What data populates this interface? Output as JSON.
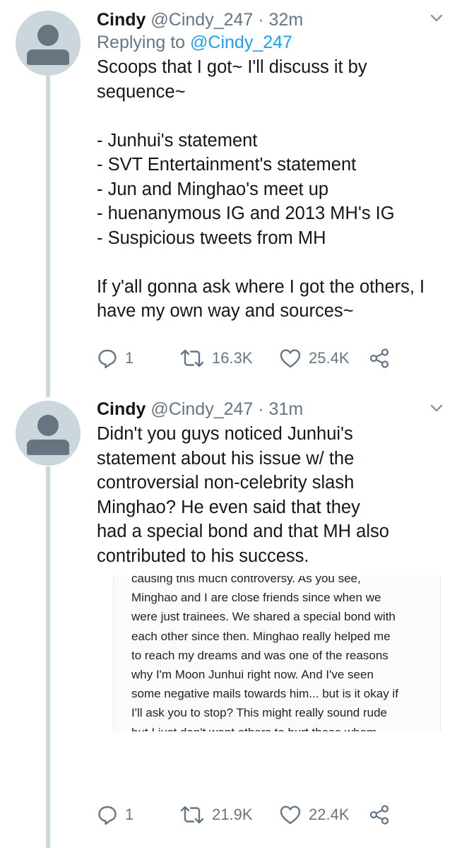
{
  "tweets": [
    {
      "name": "Cindy",
      "handle": "@Cindy_247",
      "time": "· 32m",
      "replying_label": "Replying to",
      "replying_to": "@Cindy_247",
      "text": "Scoops that I got~ I'll discuss it by\nsequence~\n\n- Junhui's statement\n- SVT Entertainment's statement\n- Jun and Minghao's meet up\n- huenanymous IG and 2013 MH's IG\n- Suspicious tweets from MH\n\nIf y'all gonna ask where I got the others, I\nhave my own way and sources~",
      "replies": "1",
      "retweets": "16.3K",
      "likes": "25.4K"
    },
    {
      "name": "Cindy",
      "handle": "@Cindy_247",
      "time": "· 31m",
      "text": "Didn't you guys noticed Junhui's\nstatement about his issue w/ the\ncontroversial non-celebrity slash\nMinghao? He even said that they\nhad a special bond and that MH also\ncontributed to his success.",
      "image_text": "causing this much controversy. As you see,\nMinghao and I are close friends since when we\nwere just trainees. We shared a special bond with\neach other since then. Minghao really helped me\nto reach my dreams and was one of the reasons\nwhy I'm Moon Junhui right now. And I've seen\nsome negative mails towards him... but is it okay if\nI'll ask you to stop? This might really sound rude\nbut I just don't want others to hurt those whom\nare special for me. May it be friends, family and\nthat includes you guys, too. Let's spread positivity",
      "replies": "1",
      "retweets": "21.9K",
      "likes": "22.4K"
    }
  ],
  "colors": {
    "text": "#14171a",
    "secondary": "#657786",
    "link": "#1da1f2",
    "thread_line": "#ccd6dd"
  },
  "icons": [
    "chevron-down-icon",
    "reply-icon",
    "retweet-icon",
    "like-icon",
    "share-icon"
  ]
}
